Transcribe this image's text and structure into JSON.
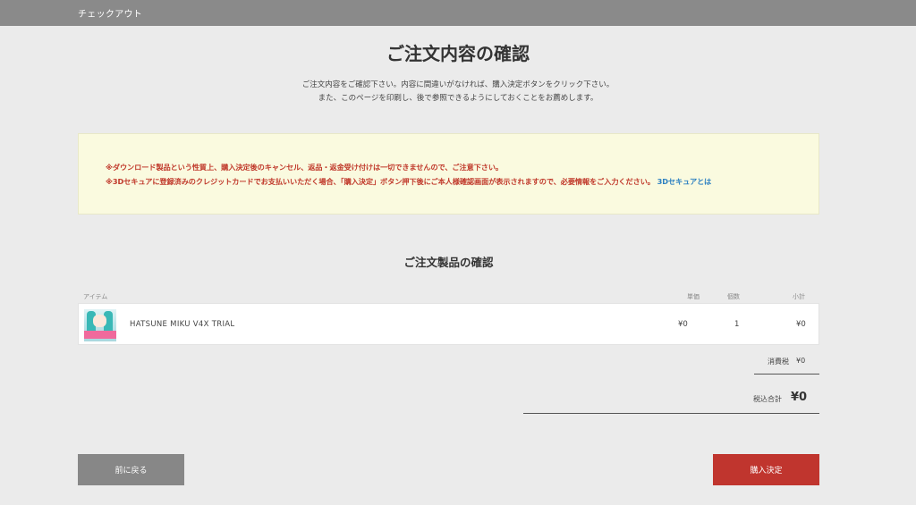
{
  "header": {
    "title": "チェックアウト"
  },
  "page": {
    "title": "ご注文内容の確認",
    "intro_line1": "ご注文内容をご確認下さい。内容に間違いがなければ、購入決定ボタンをクリック下さい。",
    "intro_line2": "また、このページを印刷し、後で参照できるようにしておくことをお薦めします。"
  },
  "notice": {
    "line1": "※ダウンロード製品という性質上、購入決定後のキャンセル、返品・返金受け付けは一切できませんので、ご注意下さい。",
    "line2": "※3Dセキュアに登録済みのクレジットカードでお支払いいただく場合、「購入決定」ボタン押下後にご本人様確認画面が表示されますので、必要情報をご入力ください。",
    "link": "3Dセキュアとは"
  },
  "order": {
    "section_title": "ご注文製品の確認",
    "columns": {
      "item": "アイテム",
      "unit_price": "単価",
      "quantity": "個数",
      "subtotal": "小計"
    },
    "items": [
      {
        "name": "HATSUNE MIKU V4X TRIAL",
        "unit_price": "¥0",
        "quantity": "1",
        "subtotal": "¥0",
        "thumbnail_icon": "product-thumbnail"
      }
    ],
    "tax_label": "消費税",
    "tax_value": "¥0",
    "total_label": "税込合計",
    "total_value": "¥0"
  },
  "buttons": {
    "back": "前に戻る",
    "purchase": "購入決定"
  },
  "colors": {
    "background": "#ebebeb",
    "topbar": "#8a8a8a",
    "notice_bg": "#fafadf",
    "notice_text": "#c0392b",
    "link": "#2b7fc1",
    "purchase_button": "#c0352e",
    "back_button": "#878787"
  }
}
